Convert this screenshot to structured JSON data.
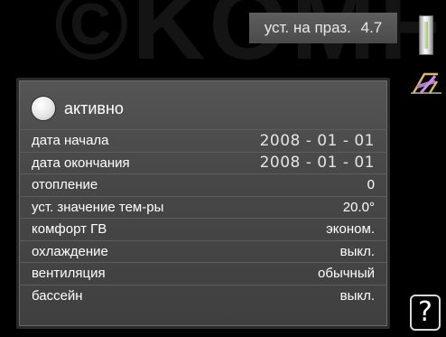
{
  "watermark": "©KOMF",
  "header": {
    "menu_title": "уст. на праз.",
    "menu_number": "4.7"
  },
  "panel": {
    "active_label": "активно",
    "active_selected": false,
    "rows": [
      {
        "label": "дата начала",
        "value": "2008 - 01 - 01"
      },
      {
        "label": "дата окончания",
        "value": "2008 - 01 - 01"
      },
      {
        "label": "отопление",
        "value": "0"
      },
      {
        "label": "уст. значение тем-ры",
        "value": "20.0°"
      },
      {
        "label": "комфорт ГВ",
        "value": "эконом."
      },
      {
        "label": "охлаждение",
        "value": "выкл."
      },
      {
        "label": "вентиляция",
        "value": "обычный"
      },
      {
        "label": "бассейн",
        "value": "выкл."
      }
    ]
  },
  "sidebar": {
    "icons": [
      "thermometer-icon",
      "holiday-deckchair-icon"
    ],
    "help_label": "?"
  },
  "colors": {
    "background": "#000000",
    "panel": "#474747",
    "title_bar": "#555555",
    "text": "#ffffff"
  }
}
